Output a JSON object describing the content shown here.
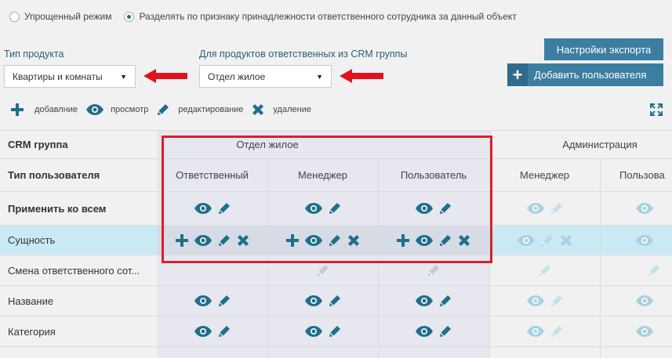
{
  "mode": {
    "option_simple": "Упрощенный режим",
    "option_split": "Разделять по признаку принадлежности ответственного сотрудника за данный объект"
  },
  "product_type": {
    "label": "Тип продукта",
    "value": "Квартиры и комнаты"
  },
  "crm_group_select": {
    "label": "Для продуктов ответственных из CRM группы",
    "value": "Отдел жилое"
  },
  "buttons": {
    "export_settings": "Настройки экспорта",
    "add_user": "Добавить пользователя"
  },
  "legend": {
    "add": "добавлние",
    "view": "просмотр",
    "edit": "редактирование",
    "delete": "удаление"
  },
  "table": {
    "row_labels": {
      "crm_group": "CRM группа",
      "user_type": "Тип пользователя",
      "apply_all": "Применить ко всем",
      "entity": "Сущность",
      "change_responsible": "Смена ответственного сот...",
      "name": "Название",
      "category": "Категория"
    },
    "groups": [
      "Отдел жилое",
      "Администрация"
    ],
    "columns": [
      "Ответственный",
      "Менеджер",
      "Пользователь",
      "Менеджер",
      "Пользова"
    ]
  },
  "colors": {
    "accent": "#1f6f8b",
    "icon_dim": "#a9d2df",
    "highlight_row": "#c9eaf5",
    "red": "#d9202c"
  }
}
